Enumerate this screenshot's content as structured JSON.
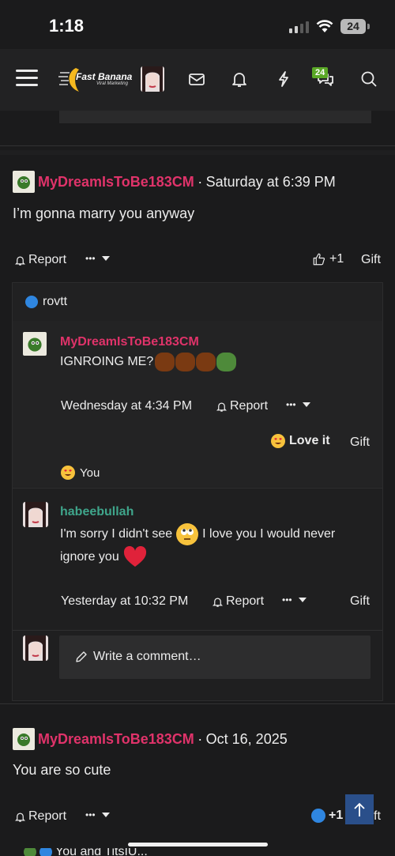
{
  "status": {
    "time": "1:18",
    "battery": "24"
  },
  "nav": {
    "logo_text": "Fast Banana",
    "logo_sub": "Viral Marketing",
    "badge_count": "24"
  },
  "post1": {
    "username": "MyDreamIsToBe183CM",
    "separator": "·",
    "date": "Saturday at 6:39 PM",
    "body": "I’m gonna marry you anyway",
    "report": "Report",
    "more": "•••",
    "like_count": "+1",
    "gift": "Gift"
  },
  "reactions": {
    "user": "rovtt"
  },
  "comment1": {
    "username": "MyDreamIsToBe183CM",
    "text": "IGNROING ME?",
    "date": "Wednesday at 4:34 PM",
    "report": "Report",
    "more": "•••",
    "love_label": "Love it",
    "gift": "Gift",
    "reactor": "You"
  },
  "comment2": {
    "username": "habeebullah",
    "text_a": "I'm sorry I didn't see",
    "text_b": "I love you I would never",
    "text_c": "ignore you",
    "date": "Yesterday at 10:32 PM",
    "report": "Report",
    "more": "•••",
    "gift": "Gift"
  },
  "write_comment": {
    "placeholder": "Write a comment…"
  },
  "post2": {
    "username": "MyDreamIsToBe183CM",
    "separator": "·",
    "date": "Oct 16, 2025",
    "body": "You are so cute",
    "report": "Report",
    "more": "•••",
    "like_count": "+1",
    "gift": "Gift",
    "reactions_partial": "You and TitsIU..."
  },
  "colors": {
    "username": "#e0336a",
    "teal_username": "#3fa58b",
    "badge": "#5aa826",
    "like_blue": "#2f86e0"
  }
}
